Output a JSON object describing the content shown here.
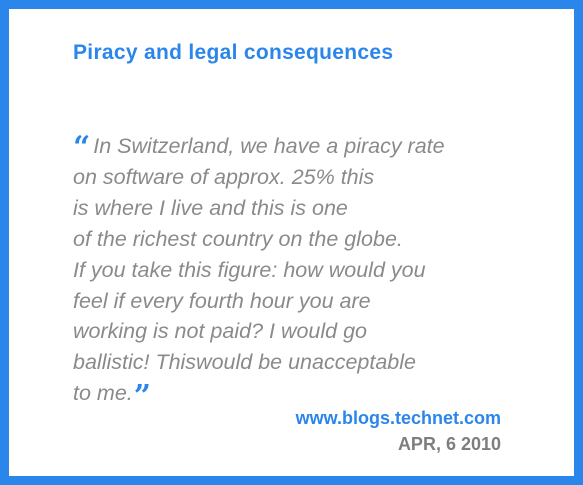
{
  "card": {
    "title": "Piracy and legal consequences",
    "quote": {
      "open_mark": "“",
      "close_mark": "”",
      "lines": [
        "In Switzerland, we have a piracy rate",
        "on software of approx. 25% this",
        "is where I live and this is one",
        "of the richest country on the globe.",
        "If you take this figure: how would you",
        "feel if every fourth hour you are",
        "working is not paid? I would go",
        "ballistic! Thiswould be unacceptable",
        "to me."
      ]
    },
    "source": "www.blogs.technet.com",
    "date": "APR, 6 2010"
  },
  "colors": {
    "accent": "#2b86ec",
    "quote_text": "#8a8a8a",
    "date_text": "#7e7e7e",
    "background": "#ffffff"
  }
}
